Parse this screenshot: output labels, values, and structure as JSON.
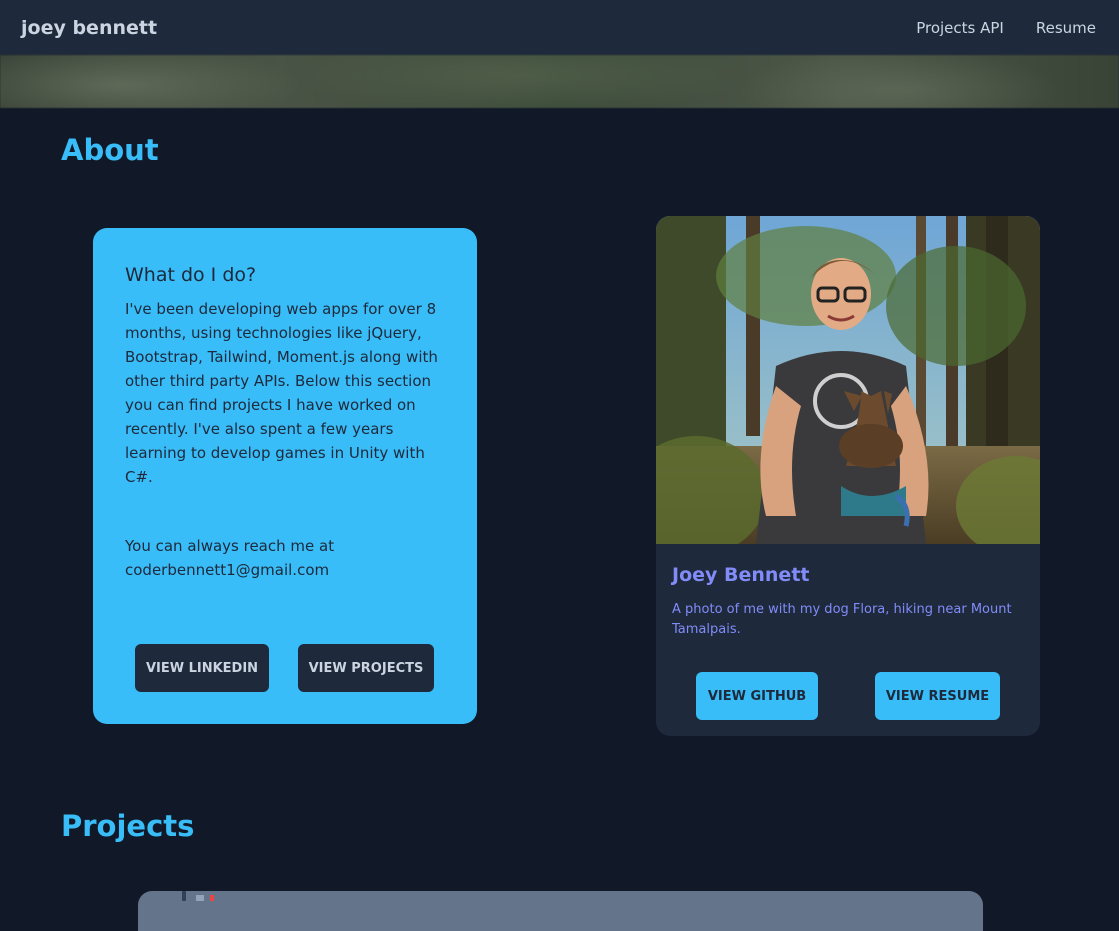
{
  "nav": {
    "brand": "joey bennett",
    "links": [
      "Projects API",
      "Resume"
    ]
  },
  "about": {
    "title": "About",
    "info_card": {
      "heading": "What do I do?",
      "body": "I've been developing web apps for over 8 months, using technologies like jQuery, Bootstrap, Tailwind, Moment.js along with other third party APIs. Below this section you can find projects I have worked on recently. I've also spent a few years learning to develop games in Unity with C#.",
      "reach_line1": "You can always reach me at",
      "email": "coderbennett1@gmail.com",
      "buttons": [
        "VIEW LINKEDIN",
        "VIEW PROJECTS"
      ]
    },
    "profile_card": {
      "name": "Joey Bennett",
      "caption": "A photo of me with my dog Flora, hiking near Mount Tamalpais.",
      "buttons": [
        "VIEW GITHUB",
        "VIEW RESUME"
      ]
    }
  },
  "projects": {
    "title": "Projects"
  },
  "colors": {
    "page_bg": "#111827",
    "nav_bg": "#1e293b",
    "accent": "#38bdf8",
    "card_dark": "#1e293b",
    "indigo_text": "#818cf8"
  }
}
